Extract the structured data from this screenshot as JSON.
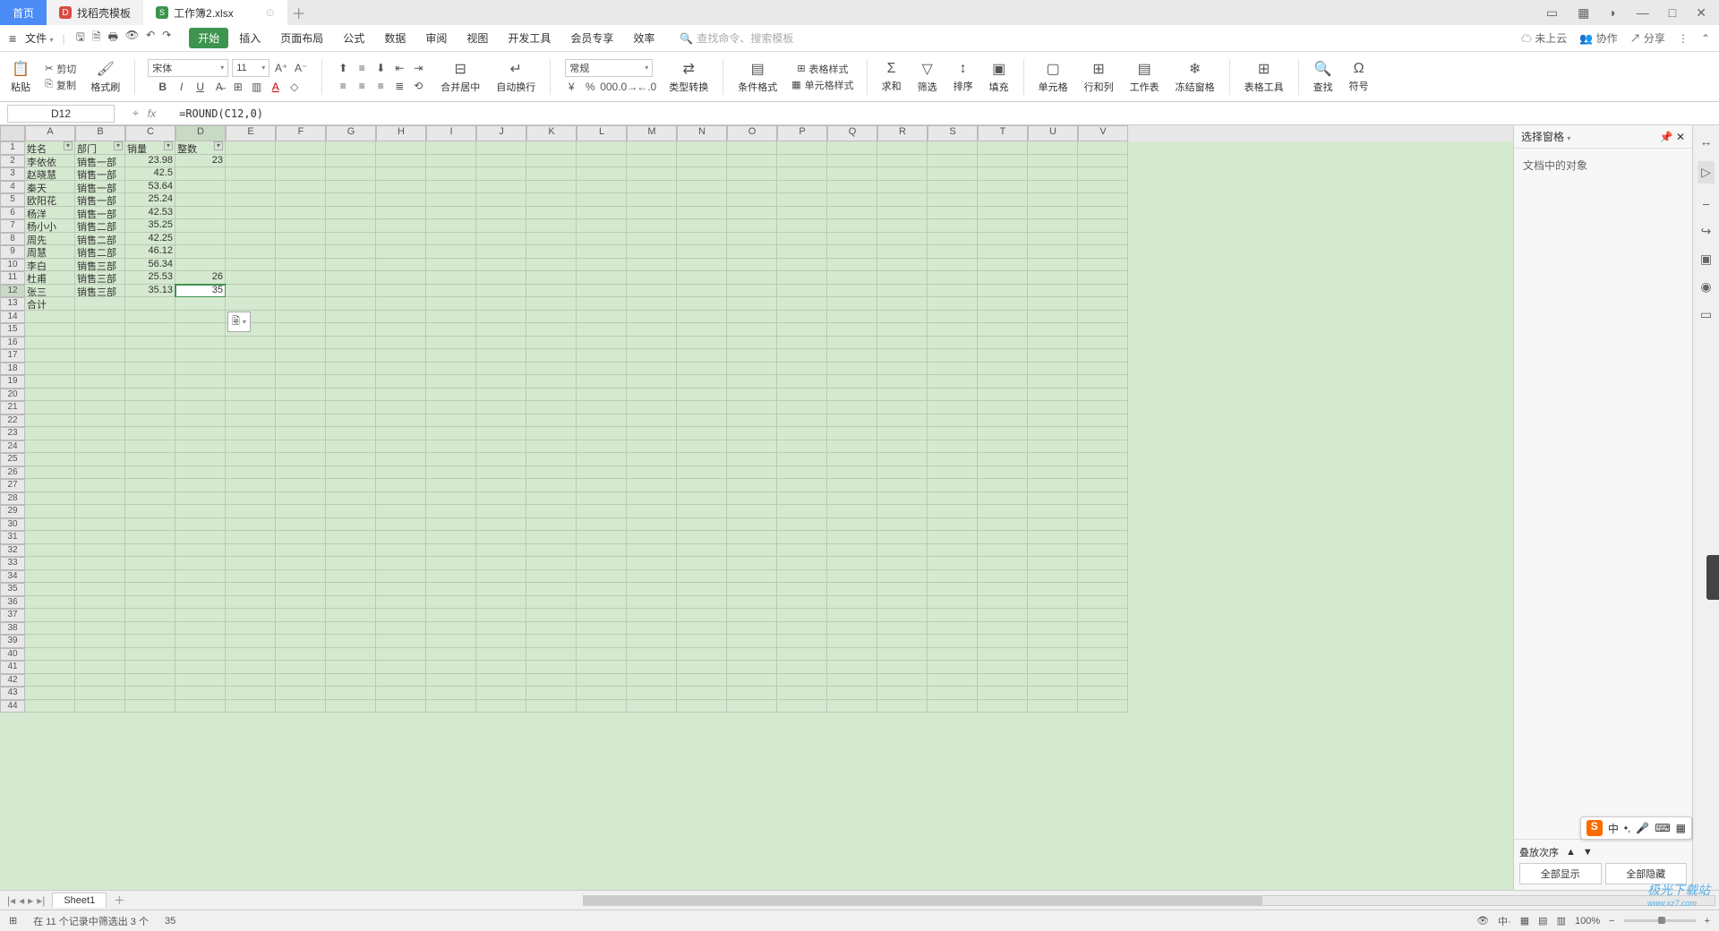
{
  "tabs": {
    "home": "首页",
    "tpl": "找稻壳模板",
    "doc": "工作簿2.xlsx"
  },
  "menu": {
    "file": "文件",
    "items": [
      "开始",
      "插入",
      "页面布局",
      "公式",
      "数据",
      "审阅",
      "视图",
      "开发工具",
      "会员专享",
      "效率"
    ],
    "searchPlaceholder": "查找命令、搜索模板",
    "cloud": "未上云",
    "collab": "协作",
    "share": "分享"
  },
  "ribbon": {
    "paste": "粘贴",
    "cut": "剪切",
    "copy": "复制",
    "format": "格式刷",
    "font": "宋体",
    "fontSize": "11",
    "merge": "合并居中",
    "wrap": "自动换行",
    "numFormat": "常规",
    "typeConv": "类型转换",
    "cond": "条件格式",
    "cellStyle": "单元格样式",
    "tableStyle": "表格样式",
    "sum": "求和",
    "filter": "筛选",
    "sort": "排序",
    "fill": "填充",
    "cell": "单元格",
    "rowcol": "行和列",
    "sheet": "工作表",
    "freeze": "冻结窗格",
    "tableTool": "表格工具",
    "find": "查找",
    "symbol": "符号"
  },
  "formula": {
    "nameBox": "D12",
    "value": "=ROUND(C12,0)"
  },
  "columns": [
    "A",
    "B",
    "C",
    "D",
    "E",
    "F",
    "G",
    "H",
    "I",
    "J",
    "K",
    "L",
    "M",
    "N",
    "O",
    "P",
    "Q",
    "R",
    "S",
    "T",
    "U",
    "V"
  ],
  "headers": {
    "A": "姓名",
    "B": "部门",
    "C": "销量",
    "D": "整数"
  },
  "rows": [
    {
      "A": "李依依",
      "B": "销售一部",
      "C": "23.98",
      "D": "23"
    },
    {
      "A": "赵晓慧",
      "B": "销售一部",
      "C": "42.5",
      "D": ""
    },
    {
      "A": "秦天",
      "B": "销售一部",
      "C": "53.64",
      "D": ""
    },
    {
      "A": "欧阳花",
      "B": "销售一部",
      "C": "25.24",
      "D": ""
    },
    {
      "A": "杨洋",
      "B": "销售一部",
      "C": "42.53",
      "D": ""
    },
    {
      "A": "杨小小",
      "B": "销售二部",
      "C": "35.25",
      "D": ""
    },
    {
      "A": "周先",
      "B": "销售二部",
      "C": "42.25",
      "D": ""
    },
    {
      "A": "周慧",
      "B": "销售二部",
      "C": "46.12",
      "D": ""
    },
    {
      "A": "李白",
      "B": "销售三部",
      "C": "56.34",
      "D": ""
    },
    {
      "A": "杜甫",
      "B": "销售三部",
      "C": "25.53",
      "D": "26"
    },
    {
      "A": "张三",
      "B": "销售三部",
      "C": "35.13",
      "D": "35"
    },
    {
      "A": "合计",
      "B": "",
      "C": "",
      "D": ""
    }
  ],
  "selPane": {
    "title": "选择窗格",
    "body": "文档中的对象",
    "order": "叠放次序",
    "showAll": "全部显示",
    "hideAll": "全部隐藏"
  },
  "sheetTab": "Sheet1",
  "status": {
    "filter": "在 11 个记录中筛选出 3 个",
    "val": "35",
    "zoom": "100%"
  },
  "ime": "中",
  "watermark": {
    "t1": "极光下载站",
    "t2": "www.xz7.com"
  }
}
